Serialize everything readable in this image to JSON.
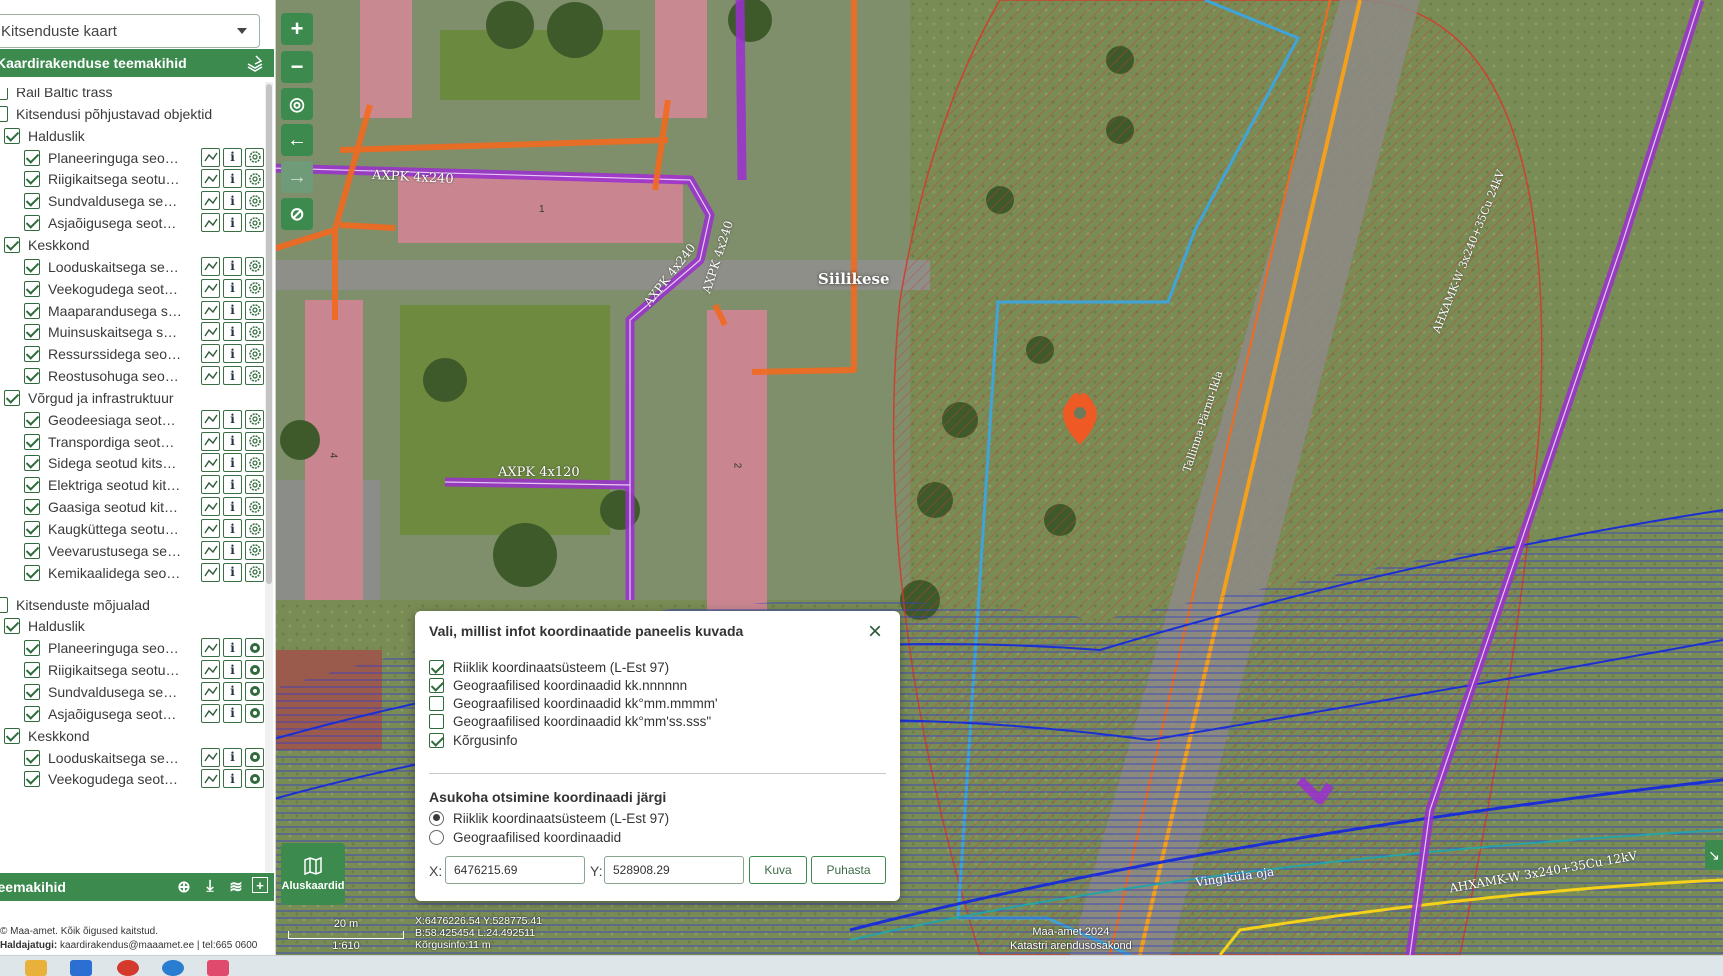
{
  "basemap": {
    "selected": "Kitsenduste kaart"
  },
  "sidebar": {
    "header": "Kaardirakenduse teemakihid",
    "tree": [
      {
        "type": "group",
        "level": 0,
        "label": "Rail Baltic trass",
        "checked": false,
        "tools": false
      },
      {
        "type": "group",
        "level": 0,
        "label": "Kitsendusi põhjustavad objektid",
        "checked": false,
        "tools": false
      },
      {
        "type": "group",
        "level": 1,
        "label": "Halduslik",
        "checked": true,
        "tools": false
      },
      {
        "type": "layer",
        "level": 2,
        "label": "Planeeringuga seotud kitsendused",
        "checked": true,
        "tools": true
      },
      {
        "type": "layer",
        "level": 2,
        "label": "Riigikaitsega seotud kitsendused",
        "checked": true,
        "tools": true
      },
      {
        "type": "layer",
        "level": 2,
        "label": "Sundvaldusega seotud kitsendused",
        "checked": true,
        "tools": true
      },
      {
        "type": "layer",
        "level": 2,
        "label": "Asjaõigusega seotud kitsendused",
        "checked": true,
        "tools": true
      },
      {
        "type": "group",
        "level": 1,
        "label": "Keskkond",
        "checked": true,
        "tools": false
      },
      {
        "type": "layer",
        "level": 2,
        "label": "Looduskaitsega seotud kitsendused",
        "checked": true,
        "tools": true
      },
      {
        "type": "layer",
        "level": 2,
        "label": "Veekogudega seotud kitsendused",
        "checked": true,
        "tools": true
      },
      {
        "type": "layer",
        "level": 2,
        "label": "Maaparandusega seotud kitsendused",
        "checked": true,
        "tools": true
      },
      {
        "type": "layer",
        "level": 2,
        "label": "Muinsuskaitsega seotud kitsendused",
        "checked": true,
        "tools": true
      },
      {
        "type": "layer",
        "level": 2,
        "label": "Ressurssidega seotud kitsendused",
        "checked": true,
        "tools": true
      },
      {
        "type": "layer",
        "level": 2,
        "label": "Reostusohuga seotud kitsendused",
        "checked": true,
        "tools": true
      },
      {
        "type": "group",
        "level": 1,
        "label": "Võrgud ja infrastruktuur",
        "checked": true,
        "tools": false
      },
      {
        "type": "layer",
        "level": 2,
        "label": "Geodeesiaga seotud kitsendused",
        "checked": true,
        "tools": true
      },
      {
        "type": "layer",
        "level": 2,
        "label": "Transpordiga seotud kitsendused",
        "checked": true,
        "tools": true
      },
      {
        "type": "layer",
        "level": 2,
        "label": "Sidega seotud kitsendused",
        "checked": true,
        "tools": true
      },
      {
        "type": "layer",
        "level": 2,
        "label": "Elektriga seotud kitsendused",
        "checked": true,
        "tools": true
      },
      {
        "type": "layer",
        "level": 2,
        "label": "Gaasiga seotud kitsendused",
        "checked": true,
        "tools": true
      },
      {
        "type": "layer",
        "level": 2,
        "label": "Kaugküttega seotud kitsendused",
        "checked": true,
        "tools": true
      },
      {
        "type": "layer",
        "level": 2,
        "label": "Veevarustusega seotud kitsendused",
        "checked": true,
        "tools": true
      },
      {
        "type": "layer",
        "level": 2,
        "label": "Kemikaalidega seotud kitsendused",
        "checked": true,
        "tools": true
      },
      {
        "type": "spacer"
      },
      {
        "type": "group",
        "level": 0,
        "label": "Kitsenduste mõjualad",
        "checked": false,
        "tools": false
      },
      {
        "type": "group",
        "level": 1,
        "label": "Halduslik",
        "checked": true,
        "tools": false
      },
      {
        "type": "layer",
        "level": 2,
        "label": "Planeeringuga seotud mõjualad",
        "checked": true,
        "tools": true,
        "gear": "filled"
      },
      {
        "type": "layer",
        "level": 2,
        "label": "Riigikaitsega seotud mõjualad",
        "checked": true,
        "tools": true,
        "gear": "filled"
      },
      {
        "type": "layer",
        "level": 2,
        "label": "Sundvaldusega seotud mõjualad",
        "checked": true,
        "tools": true,
        "gear": "filled"
      },
      {
        "type": "layer",
        "level": 2,
        "label": "Asjaõigusega seotud mõjualad",
        "checked": true,
        "tools": true,
        "gear": "filled"
      },
      {
        "type": "group",
        "level": 1,
        "label": "Keskkond",
        "checked": true,
        "tools": false
      },
      {
        "type": "layer",
        "level": 2,
        "label": "Looduskaitsega seotud mõjualad",
        "checked": true,
        "tools": true,
        "gear": "filled"
      },
      {
        "type": "layer",
        "level": 2,
        "label": "Veekogudega seotud mõjualad",
        "checked": true,
        "tools": true,
        "gear": "filled"
      }
    ],
    "bottom_header": "Teemakihid",
    "footer_line1": "© Maa-amet. Kõik õigused kaitstud.",
    "footer_line2_label": "Haldajatugi:",
    "footer_line2_value": "kaardirakendus@maaamet.ee | tel:665 0600"
  },
  "map": {
    "basemaps_label": "Aluskaardid",
    "scale_text": "20 m",
    "scale_ratio": "1:610",
    "coords_line1": "X:6476226.54 Y:528775.41",
    "coords_line2": "B:58.425454 L:24.492511",
    "coords_line3": "Kõrgusinfo:11 m",
    "copyright_line1": "Maa-amet 2024",
    "copyright_line2": "Katastri arendusosakond",
    "labels": {
      "street": "Siilikese",
      "cable1": "AXPK 4x240",
      "cable2": "AXPK 4x240",
      "cable3": "AXPK 4x240",
      "cable4": "AXPK 4x120",
      "highway": "Tallinna-Pärnu-Ikla",
      "hv1": "AHXAMK-W 3x240+35Cu 24kV",
      "hv2": "AHXAMK-W 3x240+35Cu 12kV",
      "stream": "Vingiküla oja",
      "bld1": "1",
      "bld2": "2",
      "bld4": "4"
    }
  },
  "dialog": {
    "title": "Vali, millist infot koordinaatide paneelis kuvada",
    "options": [
      {
        "label": "Riiklik koordinaatsüsteem (L-Est 97)",
        "checked": true
      },
      {
        "label": "Geograafilised koordinaadid kk.nnnnnn",
        "checked": true
      },
      {
        "label": "Geograafilised koordinaadid kk°mm.mmmm'",
        "checked": false
      },
      {
        "label": "Geograafilised koordinaadid kk°mm'ss.sss\"",
        "checked": false
      },
      {
        "label": "Kõrgusinfo",
        "checked": true
      }
    ],
    "search_title": "Asukoha otsimine koordinaadi järgi",
    "radios": [
      {
        "label": "Riiklik koordinaatsüsteem (L-Est 97)",
        "selected": true
      },
      {
        "label": "Geograafilised koordinaadid",
        "selected": false
      }
    ],
    "x_label": "X:",
    "x_value": "6476215.69",
    "y_label": "Y:",
    "y_value": "528908.29",
    "show_button": "Kuva",
    "clear_button": "Puhasta"
  },
  "colors": {
    "accent": "#3c8a4e",
    "power_cable": "#9b2fd0",
    "heating": "#f36a1f",
    "restriction_zone": "#d33a2c",
    "cadastre": "#3fa4d8",
    "marker": "#ef5a24"
  }
}
